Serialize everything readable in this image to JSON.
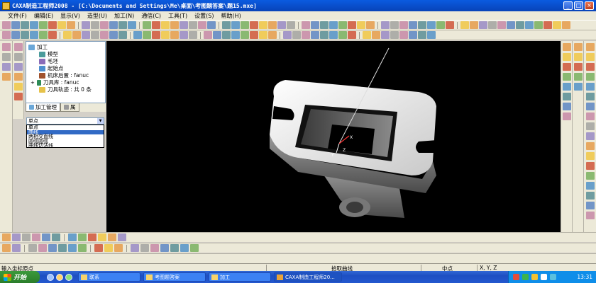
{
  "window": {
    "title": "CAXA制造工程师2008 - [C:\\Documents and Settings\\Me\\桌面\\考图题答案\\题15.mxe]"
  },
  "menu": [
    "文件(F)",
    "编辑(E)",
    "显示(V)",
    "造型(U)",
    "加工(N)",
    "通信(C)",
    "工具(T)",
    "设置(S)",
    "帮助(H)"
  ],
  "tree": {
    "root": "加工",
    "items": [
      "模型",
      "毛坯",
      "起始点",
      "机床后置 : fanuc",
      "刀具库 : fanuc",
      "刀具轨迹 : 共 0 条"
    ]
  },
  "panel_tabs": [
    "加工管理",
    "属"
  ],
  "select": {
    "value": "单点",
    "options": [
      "单点",
      "曲线",
      "两相交直线",
      "圆弧圆弧",
      "曲线切法线"
    ],
    "selected_index": 1
  },
  "status": {
    "prompt": "输入坐标原点",
    "mode": "拾取曲线",
    "snap": "中点",
    "coords": "X, Y, Z"
  },
  "taskbar": {
    "start": "开始",
    "tasks": [
      "联系",
      "考图题答案",
      "加工",
      "CAXA制造工程师20..."
    ],
    "active_index": 3,
    "clock": "13:31"
  },
  "axis_labels": {
    "x": "X",
    "y": "Y",
    "z": "Z"
  },
  "colors": {
    "title_bar": "#0a5be0",
    "viewport_bg": "#000000",
    "taskbar": "#2458cf",
    "start_button": "#3c9a3c",
    "selection": "#316ac5"
  }
}
